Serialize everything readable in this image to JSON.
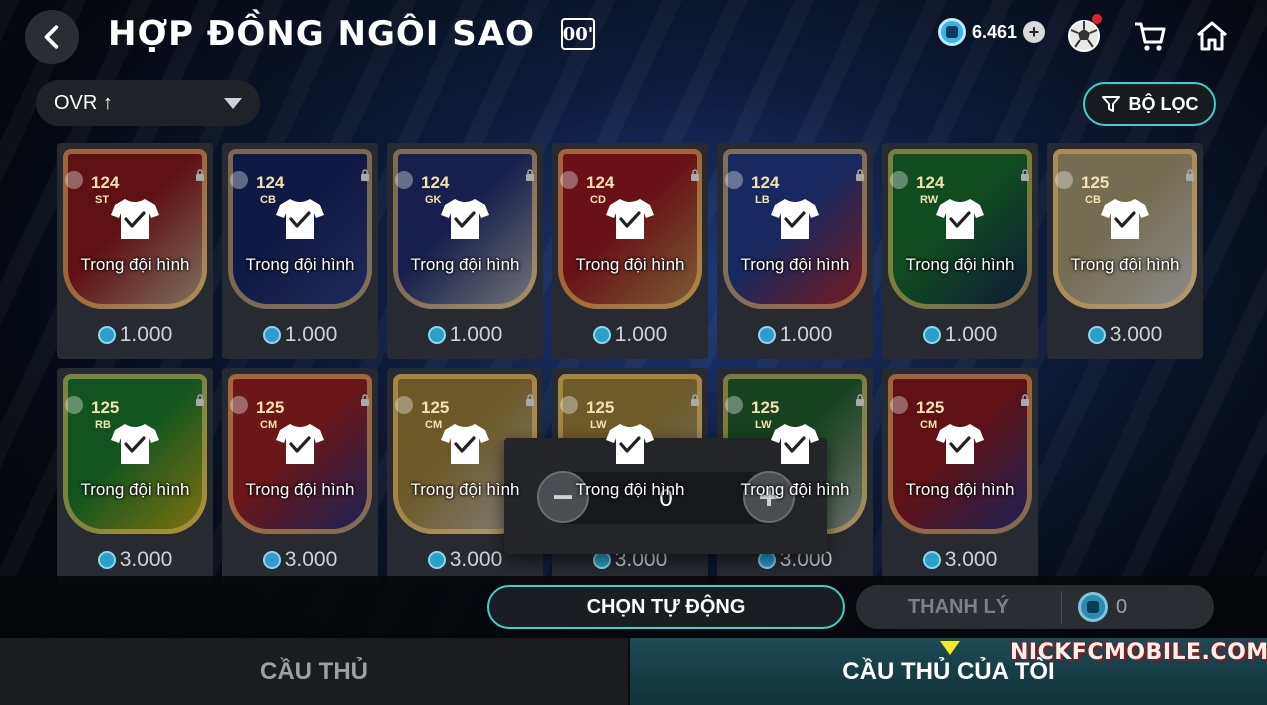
{
  "header": {
    "title": "HỢP ĐỒNG NGÔI SAO",
    "season_badge": "00'",
    "coin_balance": "6.461",
    "icons": [
      "back-arrow-icon",
      "plus-icon",
      "football-icon",
      "cart-icon",
      "home-icon"
    ]
  },
  "controls": {
    "sort_label": "OVR ↑",
    "filter_label": "BỘ LỌC"
  },
  "cards": [
    {
      "ovr": "124",
      "pos": "ST",
      "status": "Trong đội hình",
      "price": "1.000",
      "bg": [
        "#b01f26",
        "#e8d8b0"
      ]
    },
    {
      "ovr": "124",
      "pos": "CB",
      "status": "Trong đội hình",
      "price": "1.000",
      "bg": [
        "#1d2f7a",
        "#3b4fa8"
      ]
    },
    {
      "ovr": "124",
      "pos": "GK",
      "status": "Trong đội hình",
      "price": "1.000",
      "bg": [
        "#2c3a8a",
        "#d9d9e0"
      ]
    },
    {
      "ovr": "124",
      "pos": "CD",
      "status": "Trong đội hình",
      "price": "1.000",
      "bg": [
        "#c0202a",
        "#e0b060"
      ]
    },
    {
      "ovr": "124",
      "pos": "LB",
      "status": "Trong đội hình",
      "price": "1.000",
      "bg": [
        "#2a4bb0",
        "#e03030"
      ]
    },
    {
      "ovr": "124",
      "pos": "RW",
      "status": "Trong đội hình",
      "price": "1.000",
      "bg": [
        "#1f8a3a",
        "#1b2a6a"
      ]
    },
    {
      "ovr": "125",
      "pos": "CB",
      "status": "Trong đội hình",
      "price": "3.000",
      "bg": [
        "#d6c796",
        "#ffffff"
      ]
    },
    {
      "ovr": "125",
      "pos": "RB",
      "status": "Trong đội hình",
      "price": "3.000",
      "bg": [
        "#229a3a",
        "#f3d21a"
      ]
    },
    {
      "ovr": "125",
      "pos": "CM",
      "status": "Trong đội hình",
      "price": "3.000",
      "bg": [
        "#c42a2a",
        "#2a3fa0"
      ]
    },
    {
      "ovr": "125",
      "pos": "CM",
      "status": "Trong đội hình",
      "price": "3.000",
      "bg": [
        "#c7a24a",
        "#f1f1f1"
      ]
    },
    {
      "ovr": "125",
      "pos": "LW",
      "status": "Trong đội hình",
      "price": "3.000",
      "bg": [
        "#c9a64a",
        "#d0d0d0"
      ]
    },
    {
      "ovr": "125",
      "pos": "LW",
      "status": "Trong đội hình",
      "price": "3.000",
      "bg": [
        "#2a7a3a",
        "#d0d0d0"
      ]
    },
    {
      "ovr": "125",
      "pos": "CM",
      "status": "Trong đội hình",
      "price": "3.000",
      "bg": [
        "#b01f26",
        "#2a3fa0"
      ]
    }
  ],
  "quantity": {
    "value": "0",
    "minus_label": "−",
    "plus_label": "+"
  },
  "actions": {
    "auto_select_label": "CHỌN TỰ ĐỘNG",
    "sell_label": "THANH LÝ",
    "sell_coin_value": "0"
  },
  "tabs": {
    "players_label": "CẦU THỦ",
    "my_players_label": "CẦU THỦ CỦA TÔI",
    "active": "my_players"
  },
  "watermark": "NICKFCMOBILE.COM",
  "colors": {
    "accent": "#3fd0c8",
    "coin": "#35b6e6",
    "active_tab_marker": "#f4ea2a"
  }
}
